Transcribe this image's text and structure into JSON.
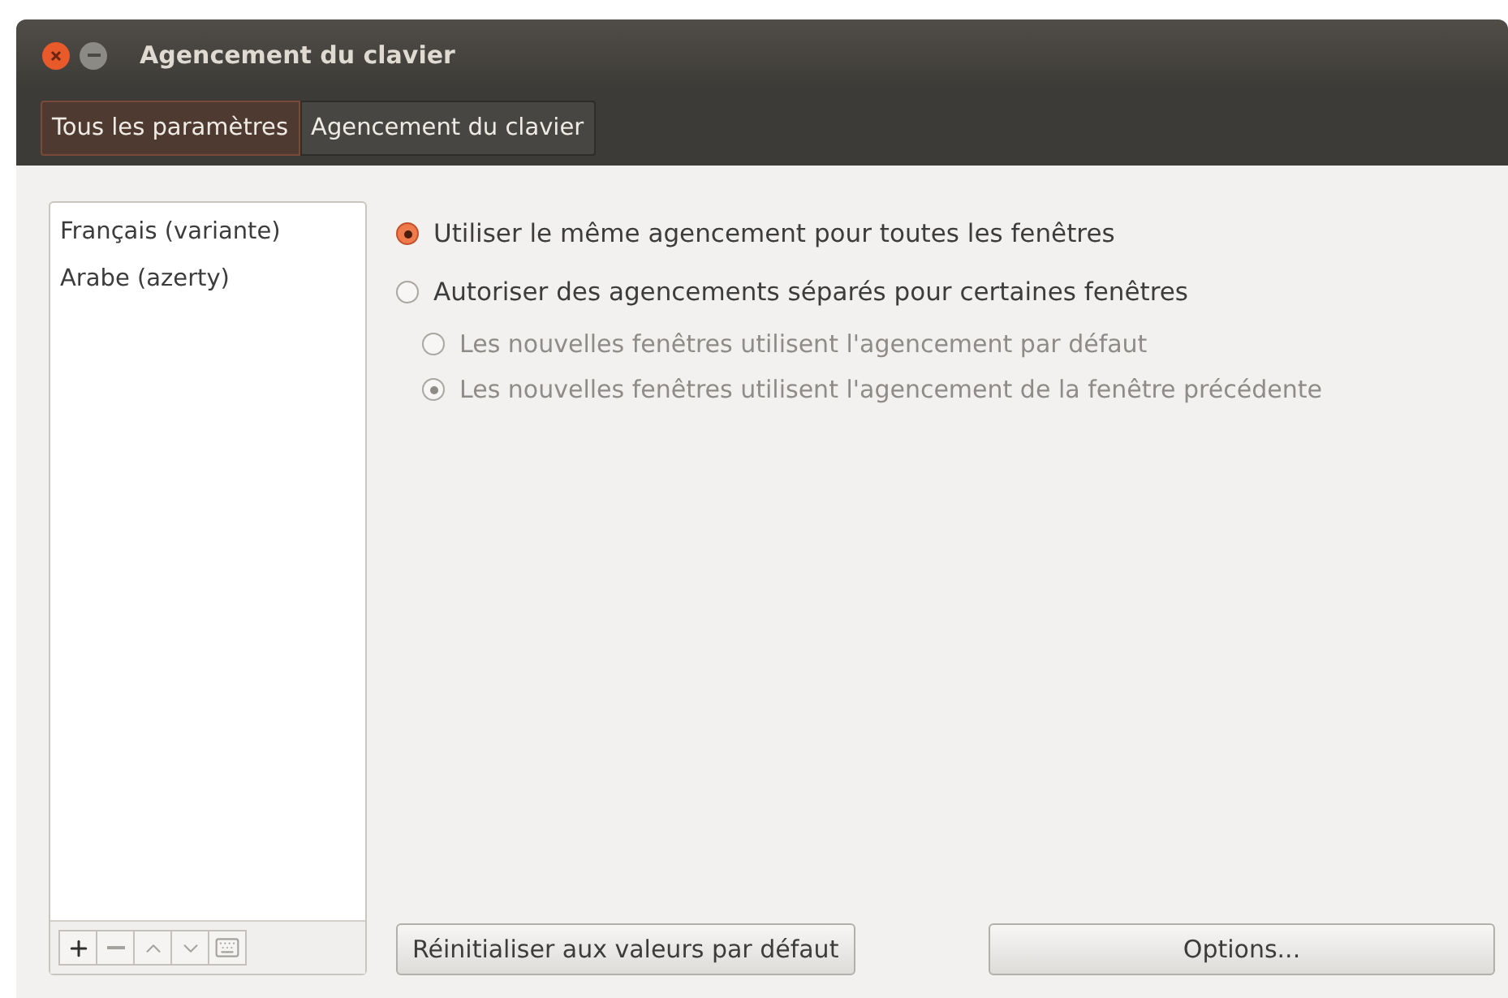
{
  "window": {
    "title": "Agencement du clavier"
  },
  "breadcrumbs": [
    {
      "label": "Tous les paramètres",
      "selected": true
    },
    {
      "label": "Agencement du clavier",
      "selected": false
    }
  ],
  "layouts": {
    "items": [
      {
        "label": "Français (variante)"
      },
      {
        "label": "Arabe (azerty)"
      }
    ],
    "toolbar": [
      {
        "kind": "add",
        "disabled": false
      },
      {
        "kind": "remove",
        "disabled": true
      },
      {
        "kind": "up",
        "disabled": true
      },
      {
        "kind": "down",
        "disabled": true
      },
      {
        "kind": "keyboard",
        "disabled": true
      }
    ]
  },
  "options": [
    {
      "label": "Utiliser le même agencement pour toutes les fenêtres",
      "selected": true,
      "disabled": false
    },
    {
      "label": "Autoriser des agencements séparés pour certaines fenêtres",
      "selected": false,
      "disabled": false,
      "children": [
        {
          "label": "Les nouvelles fenêtres utilisent l'agencement par défaut",
          "selected": false,
          "disabled": true
        },
        {
          "label": "Les nouvelles fenêtres utilisent l'agencement de la fenêtre précédente",
          "selected": true,
          "disabled": true
        }
      ]
    }
  ],
  "buttons": [
    {
      "label": "Réinitialiser aux valeurs par défaut"
    },
    {
      "label": "Options..."
    }
  ]
}
